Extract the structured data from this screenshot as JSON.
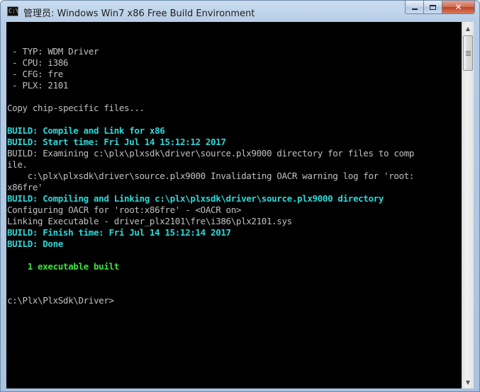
{
  "window": {
    "title": "管理员: Windows Win7 x86 Free Build Environment",
    "app_icon_text": "C:\\",
    "controls": {
      "minimize": "minimize",
      "maximize": "maximize",
      "close": "✕"
    }
  },
  "console": {
    "lines": [
      {
        "text": "",
        "color": "white"
      },
      {
        "text": " - TYP: WDM Driver",
        "color": "white"
      },
      {
        "text": " - CPU: i386",
        "color": "white"
      },
      {
        "text": " - CFG: fre",
        "color": "white"
      },
      {
        "text": " - PLX: 2101",
        "color": "white"
      },
      {
        "text": "",
        "color": "white"
      },
      {
        "text": "Copy chip-specific files...",
        "color": "white"
      },
      {
        "text": "",
        "color": "white"
      },
      {
        "text": "BUILD: Compile and Link for x86",
        "color": "cyan"
      },
      {
        "text": "BUILD: Start time: Fri Jul 14 15:12:12 2017",
        "color": "cyan"
      },
      {
        "text": "BUILD: Examining c:\\plx\\plxsdk\\driver\\source.plx9000 directory for files to comp",
        "color": "white"
      },
      {
        "text": "ile.",
        "color": "white"
      },
      {
        "text": "    c:\\plx\\plxsdk\\driver\\source.plx9000 Invalidating OACR warning log for 'root:",
        "color": "white"
      },
      {
        "text": "x86fre'",
        "color": "white"
      },
      {
        "text": "BUILD: Compiling and Linking c:\\plx\\plxsdk\\driver\\source.plx9000 directory",
        "color": "cyan"
      },
      {
        "text": "Configuring OACR for 'root:x86fre' - <OACR on>",
        "color": "white"
      },
      {
        "text": "Linking Executable - driver_plx2101\\fre\\i386\\plx2101.sys",
        "color": "white"
      },
      {
        "text": "BUILD: Finish time: Fri Jul 14 15:12:14 2017",
        "color": "cyan"
      },
      {
        "text": "BUILD: Done",
        "color": "cyan"
      },
      {
        "text": "",
        "color": "white"
      },
      {
        "text": "    1 executable built",
        "color": "green"
      },
      {
        "text": "",
        "color": "white"
      },
      {
        "text": "",
        "color": "white"
      },
      {
        "text": "c:\\Plx\\PlxSdk\\Driver>",
        "color": "white"
      }
    ]
  },
  "colors": {
    "console_bg": "#000000",
    "text_default": "#c0c0c0",
    "text_cyan": "#2ed8d8",
    "text_green": "#3fe03f",
    "title_bar": "#b7cde6",
    "close_button": "#c94a2e"
  },
  "scrollbar": {
    "up_arrow": "▲",
    "down_arrow": "▼"
  }
}
